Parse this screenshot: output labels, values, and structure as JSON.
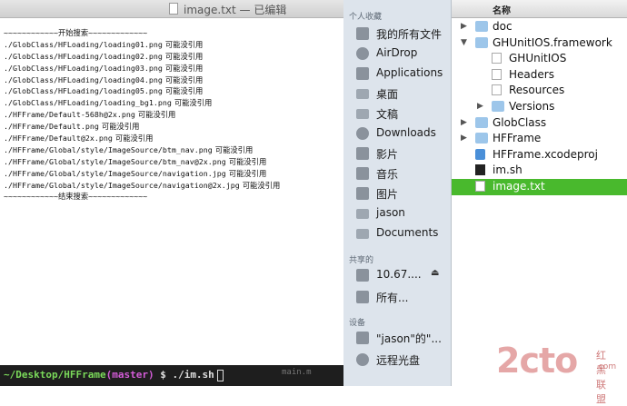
{
  "textedit": {
    "title": "image.txt — 已编辑",
    "lines": [
      {
        "path": "~~~~~~~~~~~~开始搜索~~~~~~~~~~~~~",
        "note": ""
      },
      {
        "path": "./GlobClass/HFLoading/loading01.png",
        "note": "可能没引用"
      },
      {
        "path": "./GlobClass/HFLoading/loading02.png",
        "note": "可能没引用"
      },
      {
        "path": "./GlobClass/HFLoading/loading03.png",
        "note": "可能没引用"
      },
      {
        "path": "./GlobClass/HFLoading/loading04.png",
        "note": "可能没引用"
      },
      {
        "path": "./GlobClass/HFLoading/loading05.png",
        "note": "可能没引用"
      },
      {
        "path": "./GlobClass/HFLoading/loading_bg1.png",
        "note": "可能没引用"
      },
      {
        "path": "./HFFrame/Default-568h@2x.png",
        "note": "可能没引用"
      },
      {
        "path": "./HFFrame/Default.png",
        "note": "可能没引用"
      },
      {
        "path": "./HFFrame/Default@2x.png",
        "note": "可能没引用"
      },
      {
        "path": "./HFFrame/Global/style/ImageSource/btm_nav.png",
        "note": "可能没引用"
      },
      {
        "path": "./HFFrame/Global/style/ImageSource/btm_nav@2x.png",
        "note": "可能没引用"
      },
      {
        "path": "./HFFrame/Global/style/ImageSource/navigation.jpg",
        "note": "可能没引用"
      },
      {
        "path": "./HFFrame/Global/style/ImageSource/navigation@2x.jpg",
        "note": "可能没引用"
      },
      {
        "path": "~~~~~~~~~~~~结束搜索~~~~~~~~~~~~~",
        "note": ""
      }
    ]
  },
  "terminal": {
    "path": "~/Desktop/HFFrame",
    "branch": "(master)",
    "command": " $ ./im.sh",
    "faded": "main.m"
  },
  "sidebar": {
    "favorites_header": "个人收藏",
    "favorites": [
      {
        "label": "我的所有文件",
        "icon": "all-files-icon"
      },
      {
        "label": "AirDrop",
        "icon": "airdrop-icon"
      },
      {
        "label": "Applications",
        "icon": "applications-icon"
      },
      {
        "label": "桌面",
        "icon": "desktop-icon"
      },
      {
        "label": "文稿",
        "icon": "documents-icon"
      },
      {
        "label": "Downloads",
        "icon": "downloads-icon"
      },
      {
        "label": "影片",
        "icon": "movies-icon"
      },
      {
        "label": "音乐",
        "icon": "music-icon"
      },
      {
        "label": "图片",
        "icon": "pictures-icon"
      },
      {
        "label": "jason",
        "icon": "home-icon"
      },
      {
        "label": "Documents",
        "icon": "folder-icon"
      }
    ],
    "shared_header": "共享的",
    "shared": [
      {
        "label": "10.67....",
        "icon": "server-icon"
      },
      {
        "label": "所有...",
        "icon": "network-icon"
      }
    ],
    "devices_header": "设备",
    "devices": [
      {
        "label": "\"jason\"的\"...",
        "icon": "disk-icon"
      },
      {
        "label": "远程光盘",
        "icon": "optical-disc-icon"
      }
    ]
  },
  "list": {
    "column_header": "名称",
    "items": [
      {
        "name": "doc",
        "kind": "folder",
        "expanded": false,
        "depth": 0,
        "selected": false
      },
      {
        "name": "GHUnitIOS.framework",
        "kind": "folder",
        "expanded": true,
        "depth": 0,
        "selected": false
      },
      {
        "name": "GHUnitIOS",
        "kind": "file",
        "expanded": null,
        "depth": 1,
        "selected": false
      },
      {
        "name": "Headers",
        "kind": "file",
        "expanded": null,
        "depth": 1,
        "selected": false
      },
      {
        "name": "Resources",
        "kind": "file",
        "expanded": null,
        "depth": 1,
        "selected": false
      },
      {
        "name": "Versions",
        "kind": "folder",
        "expanded": false,
        "depth": 1,
        "selected": false
      },
      {
        "name": "GlobClass",
        "kind": "folder",
        "expanded": false,
        "depth": 0,
        "selected": false
      },
      {
        "name": "HFFrame",
        "kind": "folder",
        "expanded": false,
        "depth": 0,
        "selected": false
      },
      {
        "name": "HFFrame.xcodeproj",
        "kind": "xcode",
        "expanded": null,
        "depth": 0,
        "selected": false
      },
      {
        "name": "im.sh",
        "kind": "shell",
        "expanded": null,
        "depth": 0,
        "selected": false
      },
      {
        "name": "image.txt",
        "kind": "file",
        "expanded": null,
        "depth": 0,
        "selected": true
      }
    ]
  },
  "watermark": {
    "logo": "2cto",
    "cn": "红黑联盟",
    "url": ".com"
  },
  "colors": {
    "selection": "#49b92d",
    "prompt_path": "#7ad95a",
    "prompt_branch": "#d35cd8"
  }
}
